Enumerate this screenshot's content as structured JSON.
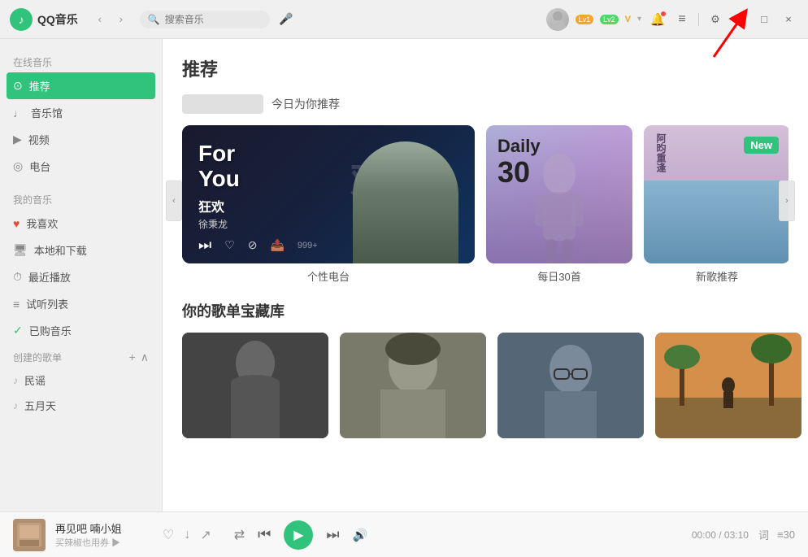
{
  "app": {
    "name": "QQ音乐",
    "logo_text": "QQ音乐"
  },
  "titlebar": {
    "search_placeholder": "搜索音乐",
    "back_label": "‹",
    "forward_label": "›",
    "level1_label": "Lv1",
    "level2_label": "Lv2",
    "minimize_label": "—",
    "maximize_label": "□",
    "close_label": "×",
    "menu_label": "≡",
    "settings_label": "⚙",
    "window_label": "⊞"
  },
  "sidebar": {
    "online_section": "在线音乐",
    "my_section": "我的音乐",
    "create_section": "创建的歌单",
    "items": [
      {
        "id": "recommend",
        "label": "推荐",
        "icon": "♪",
        "active": true
      },
      {
        "id": "music-hall",
        "label": "音乐馆",
        "icon": "♩"
      },
      {
        "id": "video",
        "label": "视频",
        "icon": "▶"
      },
      {
        "id": "radio",
        "label": "电台",
        "icon": "◎"
      }
    ],
    "my_items": [
      {
        "id": "favorite",
        "label": "我喜欢",
        "icon": "♥"
      },
      {
        "id": "local",
        "label": "本地和下载",
        "icon": "💻"
      },
      {
        "id": "recent",
        "label": "最近播放",
        "icon": "⏱"
      },
      {
        "id": "try-list",
        "label": "试听列表",
        "icon": "≡"
      },
      {
        "id": "purchased",
        "label": "已购音乐",
        "icon": "✓"
      }
    ],
    "playlists": [
      {
        "id": "folk",
        "label": "民谣"
      },
      {
        "id": "may5",
        "label": "五月天"
      }
    ]
  },
  "content": {
    "page_title": "推荐",
    "recommend_subtitle": "今日为你推荐",
    "for_you_text": "For\nYou",
    "song_title": "狂欢",
    "song_artist": "徐秉龙",
    "song_title_cn": "狂欢",
    "daily30_text": "Daily",
    "daily30_num": "30",
    "daily30_label": "每日30首",
    "new_badge": "New",
    "new_card_label": "新歌推荐",
    "personal_radio_label": "个性电台",
    "section2_title": "你的歌单宝藏库"
  },
  "player": {
    "song_name": "再见吧 喃小姐",
    "song_extra": "买辣椒也用券 ▶",
    "time_current": "00:00",
    "time_total": "03:10",
    "lyrics_label": "词",
    "playlist_label": "≡30"
  }
}
